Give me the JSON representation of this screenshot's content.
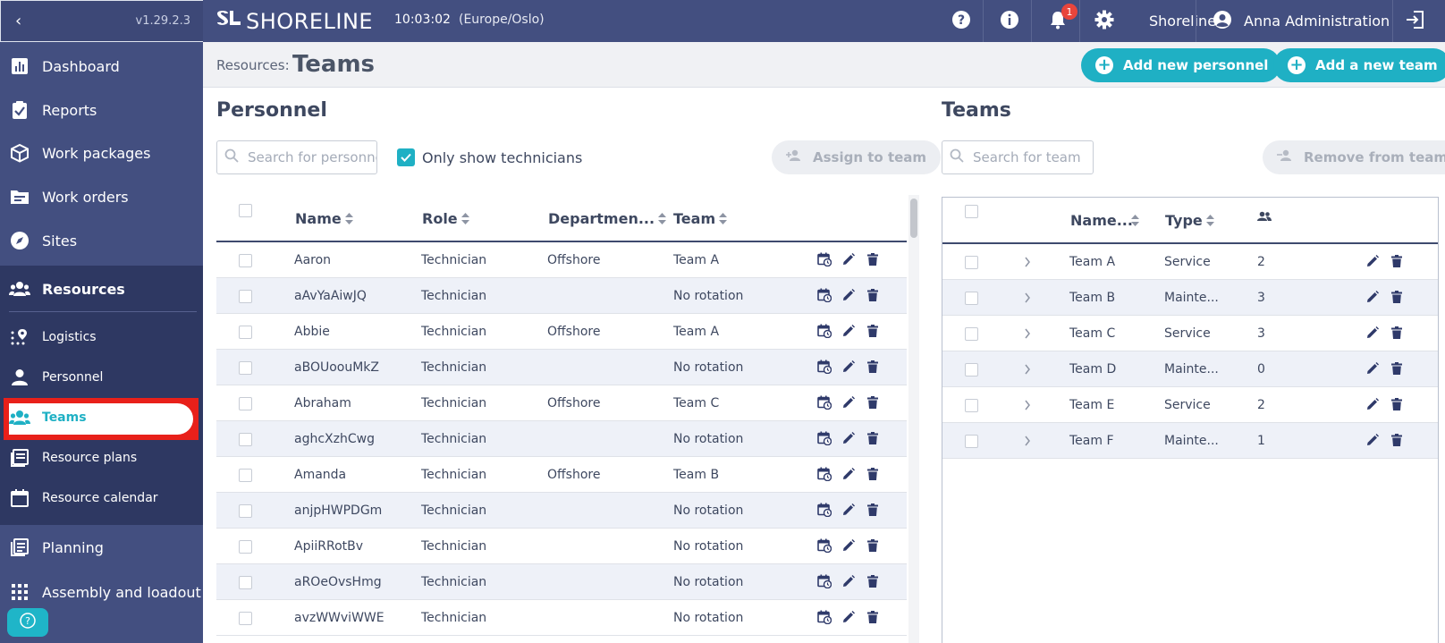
{
  "app": {
    "version": "v1.29.2.3",
    "brand": "SHORELINE",
    "time": "10:03:02",
    "timezone": "(Europe/Oslo)",
    "notification_count": "1",
    "settings_label": "Shoreline",
    "user_name": "Anna Administration"
  },
  "colors": {
    "accent": "#1fb0c4",
    "sidebar": "#434f80",
    "highlight": "#e8201a"
  },
  "sidebar": {
    "items": [
      {
        "label": "Dashboard",
        "icon": "dashboard-icon"
      },
      {
        "label": "Reports",
        "icon": "clipboard-check-icon"
      },
      {
        "label": "Work packages",
        "icon": "package-icon"
      },
      {
        "label": "Work orders",
        "icon": "folder-icon"
      },
      {
        "label": "Sites",
        "icon": "compass-icon"
      },
      {
        "label": "Resources",
        "icon": "users-icon"
      },
      {
        "label": "Logistics",
        "icon": "route-pin-icon"
      },
      {
        "label": "Personnel",
        "icon": "person-icon"
      },
      {
        "label": "Teams",
        "icon": "users-icon"
      },
      {
        "label": "Resource plans",
        "icon": "plans-icon"
      },
      {
        "label": "Resource calendar",
        "icon": "calendar-icon"
      },
      {
        "label": "Planning",
        "icon": "planning-icon"
      },
      {
        "label": "Assembly and loadout",
        "icon": "grid-icon"
      }
    ]
  },
  "header": {
    "breadcrumb": "Resources:",
    "title": "Teams",
    "add_personnel": "Add new personnel",
    "add_team": "Add a new team"
  },
  "personnel": {
    "title": "Personnel",
    "search_placeholder": "Search for personnel",
    "only_technicians": "Only show technicians",
    "assign_button": "Assign to team",
    "columns": [
      "Name",
      "Role",
      "Departmen...",
      "Team"
    ],
    "rows": [
      {
        "name": "Aaron",
        "role": "Technician",
        "department": "Offshore",
        "team": "Team A"
      },
      {
        "name": "aAvYaAiwJQ",
        "role": "Technician",
        "department": "",
        "team": "No rotation"
      },
      {
        "name": "Abbie",
        "role": "Technician",
        "department": "Offshore",
        "team": "Team A"
      },
      {
        "name": "aBOUoouMkZ",
        "role": "Technician",
        "department": "",
        "team": "No rotation"
      },
      {
        "name": "Abraham",
        "role": "Technician",
        "department": "Offshore",
        "team": "Team C"
      },
      {
        "name": "aghcXzhCwg",
        "role": "Technician",
        "department": "",
        "team": "No rotation"
      },
      {
        "name": "Amanda",
        "role": "Technician",
        "department": "Offshore",
        "team": "Team B"
      },
      {
        "name": "anjpHWPDGm",
        "role": "Technician",
        "department": "",
        "team": "No rotation"
      },
      {
        "name": "ApiiRRotBv",
        "role": "Technician",
        "department": "",
        "team": "No rotation"
      },
      {
        "name": "aROeOvsHmg",
        "role": "Technician",
        "department": "",
        "team": "No rotation"
      },
      {
        "name": "avzWWviWWE",
        "role": "Technician",
        "department": "",
        "team": "No rotation"
      }
    ]
  },
  "teams": {
    "title": "Teams",
    "search_placeholder": "Search for team",
    "remove_button": "Remove from team",
    "columns": [
      "Name...",
      "Type"
    ],
    "rows": [
      {
        "name": "Team A",
        "type": "Service",
        "count": "2"
      },
      {
        "name": "Team B",
        "type": "Mainte...",
        "count": "3"
      },
      {
        "name": "Team C",
        "type": "Service",
        "count": "3"
      },
      {
        "name": "Team D",
        "type": "Mainte...",
        "count": "0"
      },
      {
        "name": "Team E",
        "type": "Service",
        "count": "2"
      },
      {
        "name": "Team F",
        "type": "Mainte...",
        "count": "1"
      }
    ]
  }
}
